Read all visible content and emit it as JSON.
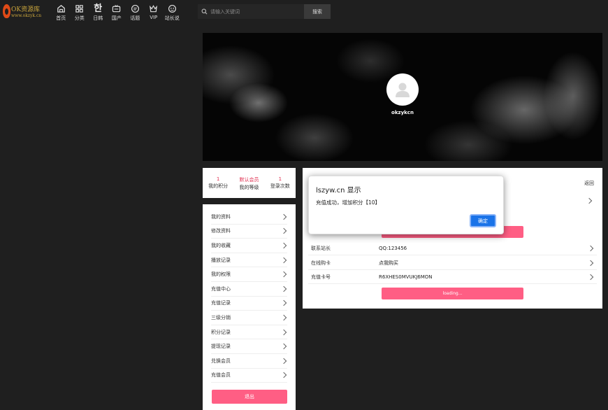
{
  "logo": {
    "line1": "OK资源库",
    "line2": "www.okzyk.cn"
  },
  "nav": [
    {
      "label": "首页",
      "icon": "home-icon"
    },
    {
      "label": "分类",
      "icon": "grid-icon"
    },
    {
      "label": "日韩",
      "icon": "hangul-icon",
      "glyph": "한"
    },
    {
      "label": "国产",
      "icon": "tv-icon"
    },
    {
      "label": "话题",
      "icon": "chat-icon"
    },
    {
      "label": "VIP",
      "icon": "crown-icon"
    },
    {
      "label": "站长说",
      "icon": "face-icon"
    }
  ],
  "search": {
    "placeholder": "请输入关键词",
    "button": "搜索"
  },
  "profile": {
    "username": "okzykcn"
  },
  "stats": [
    {
      "value": "1",
      "label": "我的积分"
    },
    {
      "value": "默认会员",
      "label": "我的等级"
    },
    {
      "value": "1",
      "label": "登录次数"
    }
  ],
  "menu": [
    "我的资料",
    "修改资料",
    "我的收藏",
    "播放记录",
    "我的权限",
    "充值中心",
    "充值记录",
    "三级分销",
    "积分记录",
    "提现记录",
    "兑换会员",
    "充值会员"
  ],
  "logout_label": "退出",
  "panel": {
    "back_label": "返回",
    "rows": [
      {
        "key": "联系站长",
        "value": "QQ:123456"
      },
      {
        "key": "在线购卡",
        "value": "点我购买"
      },
      {
        "key": "充值卡号",
        "value": "R6XHES0MVUKJ6MON"
      }
    ],
    "loading_label": "loading..."
  },
  "dialog": {
    "title": "lszyw.cn 显示",
    "message": "充值成功，增加积分【10】",
    "ok_label": "确定"
  },
  "colors": {
    "accent": "#ff5e84",
    "stat_value": "#e02e4f",
    "dialog_button": "#1a73e8"
  }
}
